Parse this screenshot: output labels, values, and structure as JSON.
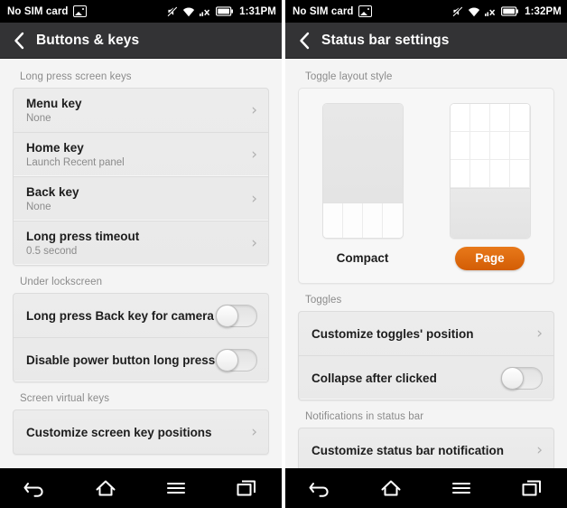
{
  "left_screen": {
    "statusbar": {
      "carrier": "No SIM card",
      "time": "1:31PM",
      "icons": [
        "sim-card-icon",
        "vibrate-off-icon",
        "wifi-icon",
        "signal-no-service-icon",
        "battery-icon"
      ]
    },
    "titlebar": {
      "back": "back-arrow",
      "title": "Buttons & keys"
    },
    "sections": [
      {
        "header": "Long press screen keys",
        "rows": [
          {
            "title": "Menu key",
            "sub": "None",
            "accessory": "chevron"
          },
          {
            "title": "Home key",
            "sub": "Launch Recent panel",
            "accessory": "chevron"
          },
          {
            "title": "Back key",
            "sub": "None",
            "accessory": "chevron"
          },
          {
            "title": "Long press timeout",
            "sub": "0.5 second",
            "accessory": "chevron"
          }
        ]
      },
      {
        "header": "Under lockscreen",
        "rows": [
          {
            "title": "Long press Back key for camera",
            "sub": "",
            "accessory": "switch",
            "switch_on": false
          },
          {
            "title": "Disable power button long press",
            "sub": "",
            "accessory": "switch",
            "switch_on": false
          }
        ]
      },
      {
        "header": "Screen virtual keys",
        "rows": [
          {
            "title": "Customize screen key positions",
            "sub": "",
            "accessory": "chevron"
          }
        ]
      }
    ],
    "navbar": [
      "back-icon",
      "home-icon",
      "menu-icon",
      "recents-icon"
    ]
  },
  "right_screen": {
    "statusbar": {
      "carrier": "No SIM card",
      "time": "1:32PM",
      "icons": [
        "sim-card-icon",
        "vibrate-off-icon",
        "wifi-icon",
        "signal-no-service-icon",
        "battery-icon"
      ]
    },
    "titlebar": {
      "back": "back-arrow",
      "title": "Status bar settings"
    },
    "layout_section": {
      "header": "Toggle layout style",
      "options": [
        {
          "label": "Compact",
          "selected": false
        },
        {
          "label": "Page",
          "selected": true
        }
      ],
      "selected_color": "#dd6a0d"
    },
    "sections": [
      {
        "header": "Toggles",
        "rows": [
          {
            "title": "Customize toggles' position",
            "sub": "",
            "accessory": "chevron"
          },
          {
            "title": "Collapse after clicked",
            "sub": "",
            "accessory": "switch",
            "switch_on": false
          }
        ]
      },
      {
        "header": "Notifications in status bar",
        "rows": [
          {
            "title": "Customize status bar notification",
            "sub": "",
            "accessory": "chevron"
          }
        ]
      }
    ],
    "navbar": [
      "back-icon",
      "home-icon",
      "menu-icon",
      "recents-icon"
    ]
  }
}
